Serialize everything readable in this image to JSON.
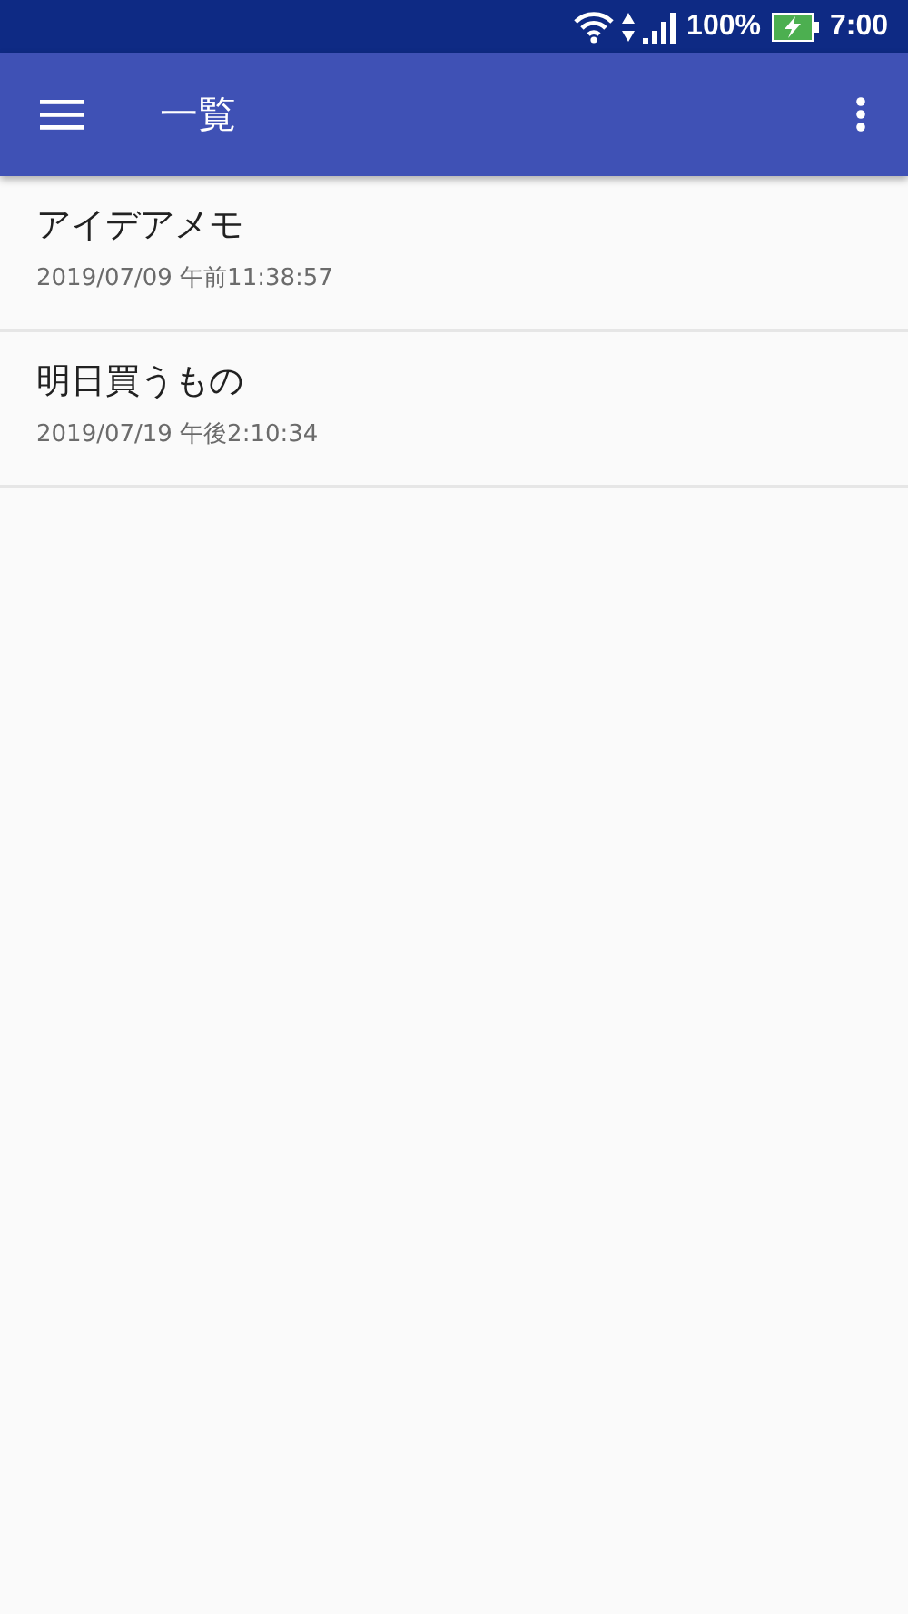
{
  "status_bar": {
    "battery": "100%",
    "time": "7:00"
  },
  "app_bar": {
    "title": "一覧"
  },
  "notes": [
    {
      "title": "アイデアメモ",
      "timestamp": "2019/07/09 午前11:38:57"
    },
    {
      "title": "明日買うもの",
      "timestamp": "2019/07/19 午後2:10:34"
    }
  ]
}
